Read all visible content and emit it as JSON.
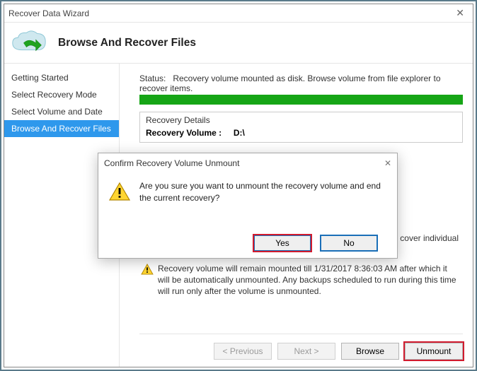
{
  "window": {
    "title": "Recover Data Wizard"
  },
  "header": {
    "heading": "Browse And Recover Files"
  },
  "sidebar": {
    "items": [
      {
        "label": "Getting Started"
      },
      {
        "label": "Select Recovery Mode"
      },
      {
        "label": "Select Volume and Date"
      },
      {
        "label": "Browse And Recover Files"
      }
    ]
  },
  "status": {
    "label": "Status:",
    "text": "Recovery volume mounted as disk. Browse volume from file explorer to recover items."
  },
  "details": {
    "legend": "Recovery Details",
    "volume_label": "Recovery Volume  :",
    "volume_value": "D:\\"
  },
  "hint_right": "cover individual",
  "warning_note": "Recovery volume will remain mounted till 1/31/2017 8:36:03 AM after which it will be automatically unmounted. Any backups scheduled to run during this time will run only after the volume is unmounted.",
  "buttons": {
    "previous": "< Previous",
    "next": "Next >",
    "browse": "Browse",
    "unmount": "Unmount"
  },
  "dialog": {
    "title": "Confirm Recovery Volume Unmount",
    "message": "Are you sure you want to unmount the recovery volume and end the current recovery?",
    "yes": "Yes",
    "no": "No"
  },
  "icons": {
    "warning": "warning-triangle-icon",
    "cloud": "cloud-restore-icon",
    "close": "close-icon"
  }
}
